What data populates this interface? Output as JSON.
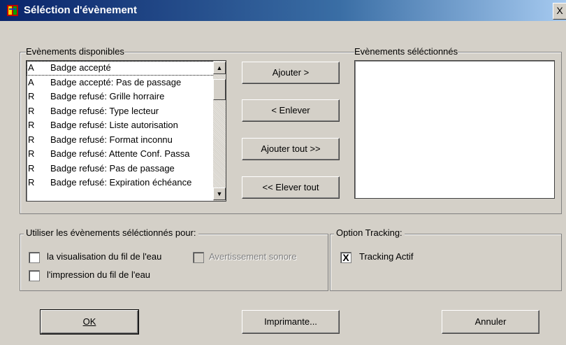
{
  "window": {
    "title": "Séléction d'évènement",
    "close_glyph": "X"
  },
  "available": {
    "label": "Evènements disponibles",
    "items": [
      {
        "code": "A",
        "label": "Badge accepté"
      },
      {
        "code": "A",
        "label": "Badge accepté: Pas de passage"
      },
      {
        "code": "R",
        "label": "Badge refusé: Grille horraire"
      },
      {
        "code": "R",
        "label": "Badge refusé: Type lecteur"
      },
      {
        "code": "R",
        "label": "Badge refusé: Liste autorisation"
      },
      {
        "code": "R",
        "label": "Badge refusé: Format inconnu"
      },
      {
        "code": "R",
        "label": "Badge refusé: Attente Conf. Passa"
      },
      {
        "code": "R",
        "label": "Badge refusé: Pas de passage"
      },
      {
        "code": "R",
        "label": "Badge refusé: Expiration échéance"
      }
    ]
  },
  "selected": {
    "label": "Evènements séléctionnés",
    "items": []
  },
  "buttons": {
    "add": "Ajouter >",
    "remove": "< Enlever",
    "add_all": "Ajouter tout >>",
    "remove_all": "<< Elever tout",
    "ok": "OK",
    "printer": "Imprimante...",
    "cancel": "Annuler"
  },
  "use_for": {
    "label": "Utiliser les évènements séléctionnés pour:",
    "options": [
      {
        "label": "la visualisation du fil de l'eau",
        "checked": false
      },
      {
        "label": "Avertissement sonore",
        "checked": false,
        "disabled": true
      },
      {
        "label": "l'impression du fil de l'eau",
        "checked": false
      }
    ]
  },
  "tracking": {
    "label": "Option Tracking:",
    "option": {
      "label": "Tracking Actif",
      "checked": true,
      "mark": "X"
    }
  }
}
